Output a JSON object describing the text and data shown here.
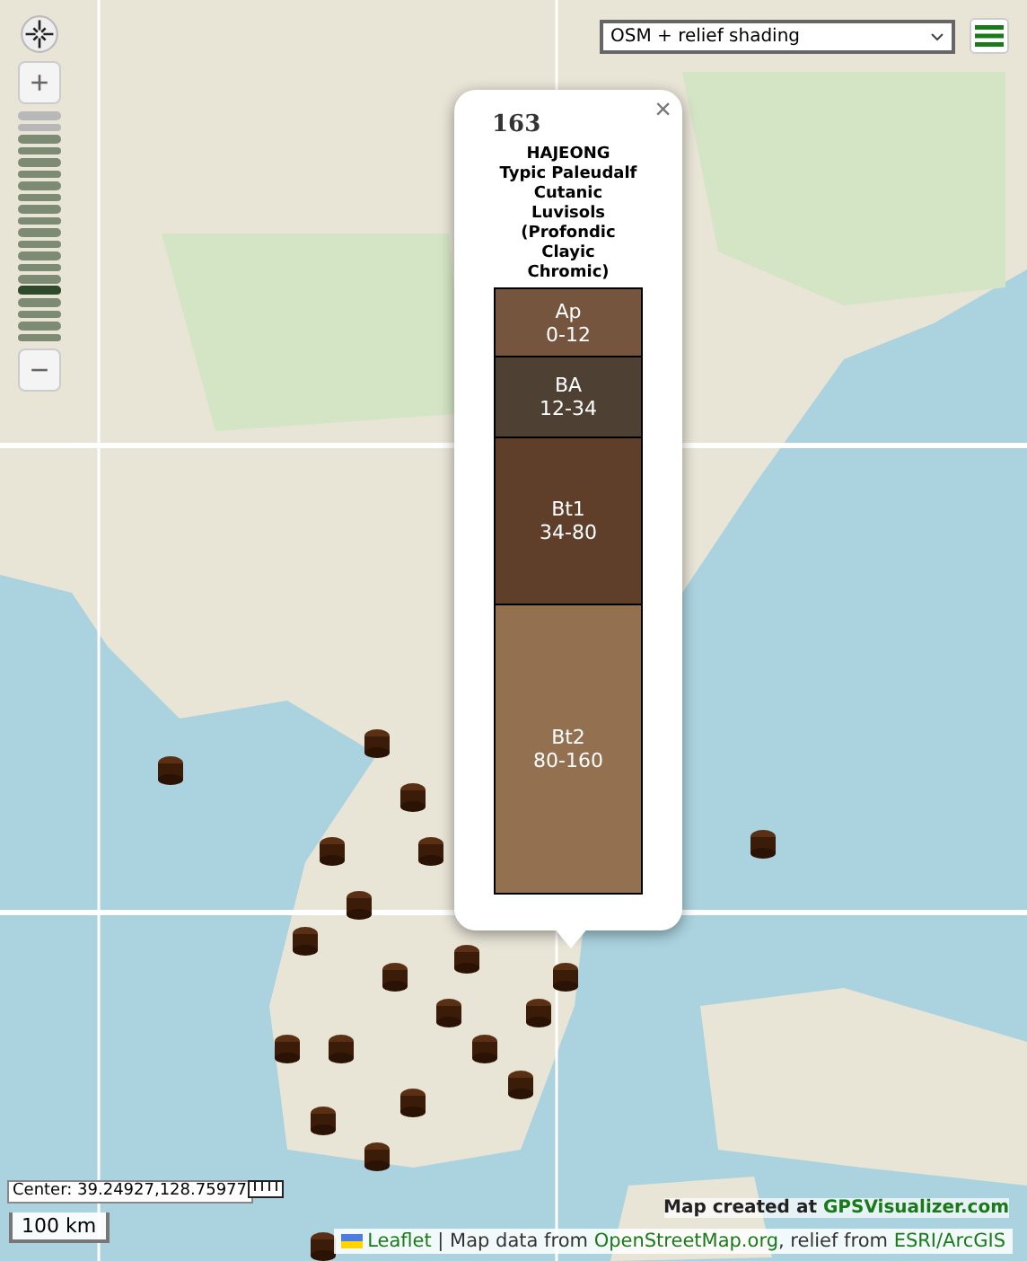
{
  "map_controls": {
    "zoom_in": "+",
    "zoom_out": "−",
    "zoom_slider": {
      "level": 0.2
    }
  },
  "layer_select": {
    "value": "OSM + relief shading"
  },
  "popup": {
    "id": "163",
    "close": "×",
    "site": "HAJEONG",
    "classification_1": "Typic Paleudalf",
    "classification_2": "Cutanic Luvisols (Profondic Clayic Chromic)",
    "horizons": [
      {
        "name": "Ap",
        "depth": "0-12",
        "color": "#75553e"
      },
      {
        "name": "BA",
        "depth": "12-34",
        "color": "#4f4034"
      },
      {
        "name": "Bt1",
        "depth": "34-80",
        "color": "#5f3f2a"
      },
      {
        "name": "Bt2",
        "depth": "80-160",
        "color": "#93704f"
      }
    ]
  },
  "center": "Center: 39.24927,128.75977",
  "scale": "100 km",
  "credit": {
    "text": "Map created at",
    "link": "GPSVisualizer.com"
  },
  "attribution": {
    "link_1": "Leaflet",
    "text_1": "| Map data from",
    "link_2": "OpenStreetMap.org",
    "text_2": ", relief from",
    "link_3": "ESRI/ArcGIS"
  }
}
